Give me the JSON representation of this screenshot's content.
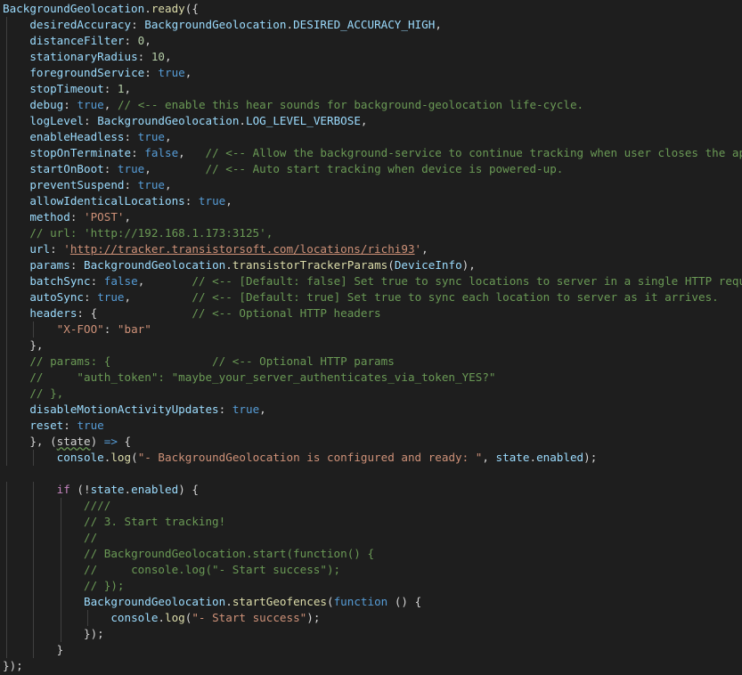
{
  "editor": {
    "colors": {
      "background": "#1e1e1e",
      "variable": "#9cdcfe",
      "function": "#dcdcaa",
      "keyword": "#569cd6",
      "control": "#c586c0",
      "string": "#ce9178",
      "number": "#b5cea8",
      "comment": "#6a9955",
      "punctuation": "#d4d4d4"
    },
    "lines": [
      [
        [
          "var",
          "BackgroundGeolocation"
        ],
        [
          "pun",
          "."
        ],
        [
          "fn",
          "ready"
        ],
        [
          "pun",
          "({"
        ]
      ],
      [
        [
          "pun",
          "    "
        ],
        [
          "var",
          "desiredAccuracy"
        ],
        [
          "pun",
          ": "
        ],
        [
          "var",
          "BackgroundGeolocation"
        ],
        [
          "pun",
          "."
        ],
        [
          "var",
          "DESIRED_ACCURACY_HIGH"
        ],
        [
          "pun",
          ","
        ]
      ],
      [
        [
          "pun",
          "    "
        ],
        [
          "var",
          "distanceFilter"
        ],
        [
          "pun",
          ": "
        ],
        [
          "num",
          "0"
        ],
        [
          "pun",
          ","
        ]
      ],
      [
        [
          "pun",
          "    "
        ],
        [
          "var",
          "stationaryRadius"
        ],
        [
          "pun",
          ": "
        ],
        [
          "num",
          "10"
        ],
        [
          "pun",
          ","
        ]
      ],
      [
        [
          "pun",
          "    "
        ],
        [
          "var",
          "foregroundService"
        ],
        [
          "pun",
          ": "
        ],
        [
          "kw",
          "true"
        ],
        [
          "pun",
          ","
        ]
      ],
      [
        [
          "pun",
          "    "
        ],
        [
          "var",
          "stopTimeout"
        ],
        [
          "pun",
          ": "
        ],
        [
          "num",
          "1"
        ],
        [
          "pun",
          ","
        ]
      ],
      [
        [
          "pun",
          "    "
        ],
        [
          "var",
          "debug"
        ],
        [
          "pun",
          ": "
        ],
        [
          "kw",
          "true"
        ],
        [
          "pun",
          ", "
        ],
        [
          "cmt",
          "// <-- enable this hear sounds for background-geolocation life-cycle."
        ]
      ],
      [
        [
          "pun",
          "    "
        ],
        [
          "var",
          "logLevel"
        ],
        [
          "pun",
          ": "
        ],
        [
          "var",
          "BackgroundGeolocation"
        ],
        [
          "pun",
          "."
        ],
        [
          "var",
          "LOG_LEVEL_VERBOSE"
        ],
        [
          "pun",
          ","
        ]
      ],
      [
        [
          "pun",
          "    "
        ],
        [
          "var",
          "enableHeadless"
        ],
        [
          "pun",
          ": "
        ],
        [
          "kw",
          "true"
        ],
        [
          "pun",
          ","
        ]
      ],
      [
        [
          "pun",
          "    "
        ],
        [
          "var",
          "stopOnTerminate"
        ],
        [
          "pun",
          ": "
        ],
        [
          "kw",
          "false"
        ],
        [
          "pun",
          ",   "
        ],
        [
          "cmt",
          "// <-- Allow the background-service to continue tracking when user closes the app."
        ]
      ],
      [
        [
          "pun",
          "    "
        ],
        [
          "var",
          "startOnBoot"
        ],
        [
          "pun",
          ": "
        ],
        [
          "kw",
          "true"
        ],
        [
          "pun",
          ",        "
        ],
        [
          "cmt",
          "// <-- Auto start tracking when device is powered-up."
        ]
      ],
      [
        [
          "pun",
          "    "
        ],
        [
          "var",
          "preventSuspend"
        ],
        [
          "pun",
          ": "
        ],
        [
          "kw",
          "true"
        ],
        [
          "pun",
          ","
        ]
      ],
      [
        [
          "pun",
          "    "
        ],
        [
          "var",
          "allowIdenticalLocations"
        ],
        [
          "pun",
          ": "
        ],
        [
          "kw",
          "true"
        ],
        [
          "pun",
          ","
        ]
      ],
      [
        [
          "pun",
          "    "
        ],
        [
          "var",
          "method"
        ],
        [
          "pun",
          ": "
        ],
        [
          "str",
          "'POST'"
        ],
        [
          "pun",
          ","
        ]
      ],
      [
        [
          "pun",
          "    "
        ],
        [
          "cmt",
          "// url: 'http://192.168.1.173:3125',"
        ]
      ],
      [
        [
          "pun",
          "    "
        ],
        [
          "var",
          "url"
        ],
        [
          "pun",
          ": "
        ],
        [
          "str",
          "'"
        ],
        [
          "link",
          "http://tracker.transistorsoft.com/locations/richi93"
        ],
        [
          "str",
          "'"
        ],
        [
          "pun",
          ","
        ]
      ],
      [
        [
          "pun",
          "    "
        ],
        [
          "var",
          "params"
        ],
        [
          "pun",
          ": "
        ],
        [
          "var",
          "BackgroundGeolocation"
        ],
        [
          "pun",
          "."
        ],
        [
          "fn",
          "transistorTrackerParams"
        ],
        [
          "pun",
          "("
        ],
        [
          "var",
          "DeviceInfo"
        ],
        [
          "pun",
          "),"
        ]
      ],
      [
        [
          "pun",
          "    "
        ],
        [
          "var",
          "batchSync"
        ],
        [
          "pun",
          ": "
        ],
        [
          "kw",
          "false"
        ],
        [
          "pun",
          ",       "
        ],
        [
          "cmt",
          "// <-- [Default: false] Set true to sync locations to server in a single HTTP request."
        ]
      ],
      [
        [
          "pun",
          "    "
        ],
        [
          "var",
          "autoSync"
        ],
        [
          "pun",
          ": "
        ],
        [
          "kw",
          "true"
        ],
        [
          "pun",
          ",         "
        ],
        [
          "cmt",
          "// <-- [Default: true] Set true to sync each location to server as it arrives."
        ]
      ],
      [
        [
          "pun",
          "    "
        ],
        [
          "var",
          "headers"
        ],
        [
          "pun",
          ": {              "
        ],
        [
          "cmt",
          "// <-- Optional HTTP headers"
        ]
      ],
      [
        [
          "pun",
          "        "
        ],
        [
          "str",
          "\"X-FOO\""
        ],
        [
          "pun",
          ": "
        ],
        [
          "str",
          "\"bar\""
        ]
      ],
      [
        [
          "pun",
          "    },"
        ]
      ],
      [
        [
          "pun",
          "    "
        ],
        [
          "cmt",
          "// params: {               // <-- Optional HTTP params"
        ]
      ],
      [
        [
          "pun",
          "    "
        ],
        [
          "cmt",
          "//     \"auth_token\": \"maybe_your_server_authenticates_via_token_YES?\""
        ]
      ],
      [
        [
          "pun",
          "    "
        ],
        [
          "cmt",
          "// },"
        ]
      ],
      [
        [
          "pun",
          "    "
        ],
        [
          "var",
          "disableMotionActivityUpdates"
        ],
        [
          "pun",
          ": "
        ],
        [
          "kw",
          "true"
        ],
        [
          "pun",
          ","
        ]
      ],
      [
        [
          "pun",
          "    "
        ],
        [
          "var",
          "reset"
        ],
        [
          "pun",
          ": "
        ],
        [
          "kw",
          "true"
        ]
      ],
      [
        [
          "pun",
          "    }, ("
        ],
        [
          "sq",
          "state"
        ],
        [
          "pun",
          ") "
        ],
        [
          "kw",
          "=>"
        ],
        [
          "pun",
          " {"
        ]
      ],
      [
        [
          "pun",
          "        "
        ],
        [
          "var",
          "console"
        ],
        [
          "pun",
          "."
        ],
        [
          "fn",
          "log"
        ],
        [
          "pun",
          "("
        ],
        [
          "str",
          "\"- BackgroundGeolocation is configured and ready: \""
        ],
        [
          "pun",
          ", "
        ],
        [
          "var",
          "state"
        ],
        [
          "pun",
          "."
        ],
        [
          "var",
          "enabled"
        ],
        [
          "pun",
          ");"
        ]
      ],
      [
        [
          "pun",
          ""
        ]
      ],
      [
        [
          "pun",
          "        "
        ],
        [
          "ctl",
          "if"
        ],
        [
          "pun",
          " (!"
        ],
        [
          "var",
          "state"
        ],
        [
          "pun",
          "."
        ],
        [
          "var",
          "enabled"
        ],
        [
          "pun",
          ") {"
        ]
      ],
      [
        [
          "pun",
          "            "
        ],
        [
          "cmt",
          "////"
        ]
      ],
      [
        [
          "pun",
          "            "
        ],
        [
          "cmt",
          "// 3. Start tracking!"
        ]
      ],
      [
        [
          "pun",
          "            "
        ],
        [
          "cmt",
          "//"
        ]
      ],
      [
        [
          "pun",
          "            "
        ],
        [
          "cmt",
          "// BackgroundGeolocation.start(function() {"
        ]
      ],
      [
        [
          "pun",
          "            "
        ],
        [
          "cmt",
          "//     console.log(\"- Start success\");"
        ]
      ],
      [
        [
          "pun",
          "            "
        ],
        [
          "cmt",
          "// });"
        ]
      ],
      [
        [
          "pun",
          "            "
        ],
        [
          "var",
          "BackgroundGeolocation"
        ],
        [
          "pun",
          "."
        ],
        [
          "fn",
          "startGeofences"
        ],
        [
          "pun",
          "("
        ],
        [
          "kw",
          "function"
        ],
        [
          "pun",
          " () {"
        ]
      ],
      [
        [
          "pun",
          "                "
        ],
        [
          "var",
          "console"
        ],
        [
          "pun",
          "."
        ],
        [
          "fn",
          "log"
        ],
        [
          "pun",
          "("
        ],
        [
          "str",
          "\"- Start success\""
        ],
        [
          "pun",
          ");"
        ]
      ],
      [
        [
          "pun",
          "            });"
        ]
      ],
      [
        [
          "pun",
          "        }"
        ]
      ],
      [
        [
          "pun",
          "});"
        ]
      ]
    ]
  }
}
